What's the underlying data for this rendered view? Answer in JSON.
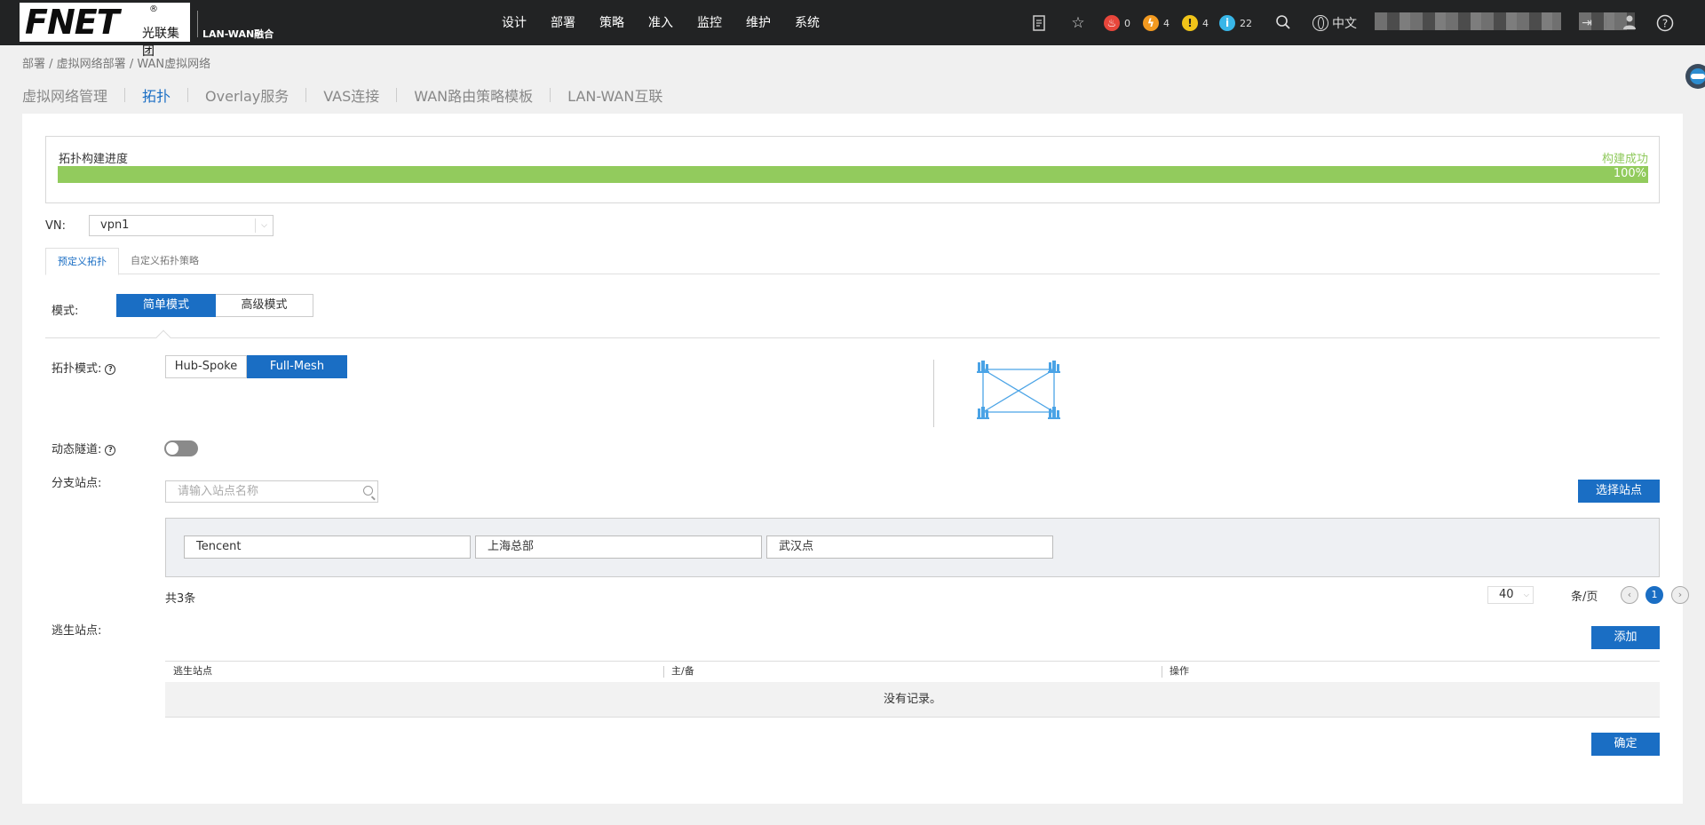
{
  "topbar": {
    "logo_text": "FNET",
    "logo_cn": "光联集团",
    "logo_sub": "LAN-WAN融合",
    "nav": [
      "设计",
      "部署",
      "策略",
      "准入",
      "监控",
      "维护",
      "系统"
    ],
    "alerts": [
      {
        "count": "0",
        "color": "#e8463b",
        "icon": "fire-icon"
      },
      {
        "count": "4",
        "color": "#f39a20",
        "icon": "lightning-icon"
      },
      {
        "count": "4",
        "color": "#f0c419",
        "icon": "exclamation-icon"
      },
      {
        "count": "22",
        "color": "#38b6e8",
        "icon": "info-icon"
      }
    ],
    "language": "中文"
  },
  "breadcrumb": [
    "部署",
    "虚拟网络部署",
    "WAN虚拟网络"
  ],
  "tabs": [
    {
      "label": "虚拟网络管理",
      "active": false
    },
    {
      "label": "拓扑",
      "active": true
    },
    {
      "label": "Overlay服务",
      "active": false
    },
    {
      "label": "VAS连接",
      "active": false
    },
    {
      "label": "WAN路由策略模板",
      "active": false
    },
    {
      "label": "LAN-WAN互联",
      "active": false
    }
  ],
  "progress": {
    "title": "拓扑构建进度",
    "status": "构建成功",
    "percent_label": "100%",
    "fraction": 1.0
  },
  "vn": {
    "label": "VN:",
    "value": "vpn1"
  },
  "subtabs": [
    {
      "label": "预定义拓扑",
      "active": true
    },
    {
      "label": "自定义拓扑策略",
      "active": false
    }
  ],
  "mode": {
    "label": "模式:",
    "options": [
      "简单模式",
      "高级模式"
    ],
    "selected": "简单模式"
  },
  "topology_mode": {
    "label": "拓扑模式:",
    "options": [
      "Hub-Spoke",
      "Full-Mesh"
    ],
    "selected": "Full-Mesh"
  },
  "dynamic_tunnel": {
    "label": "动态隧道:",
    "enabled": false
  },
  "branch_sites": {
    "label": "分支站点:",
    "search_placeholder": "请输入站点名称",
    "select_button": "选择站点",
    "sites": [
      "Tencent",
      "上海总部",
      "武汉点"
    ],
    "total": "共3条",
    "page_size": "40",
    "page_unit": "条/页",
    "current_page": "1"
  },
  "escape_sites": {
    "label": "逃生站点:",
    "add_button": "添加",
    "columns": [
      "逃生站点",
      "主/备",
      "操作"
    ],
    "empty_text": "没有记录。"
  },
  "confirm_button": "确定",
  "colors": {
    "accent": "#1a6ec4",
    "progress": "#92cb5d",
    "topbar": "#222324"
  }
}
